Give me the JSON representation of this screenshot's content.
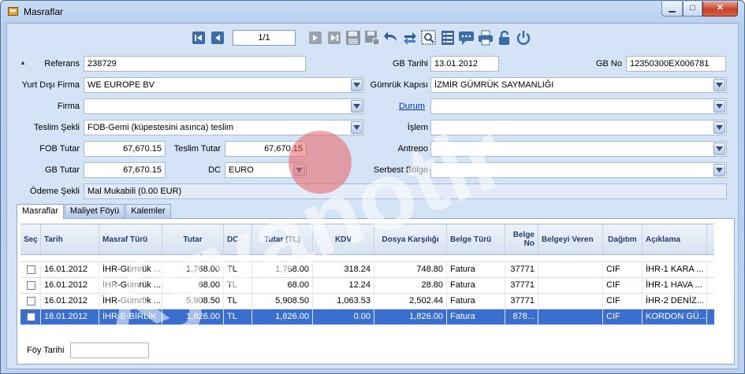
{
  "window": {
    "title": "Masraflar",
    "controls": {
      "minimize": "▁",
      "maximize": "□",
      "close": "✕"
    }
  },
  "toolbar": {
    "pager": "1/1",
    "icons": [
      "first-page-icon",
      "prev-page-icon",
      "next-page-icon",
      "last-page-icon",
      "save-icon",
      "save-as-icon",
      "undo-icon",
      "refresh-icon",
      "search-icon",
      "list-icon",
      "comment-icon",
      "print-icon",
      "lock-icon",
      "power-icon"
    ]
  },
  "form": {
    "referans_label": "Referans",
    "referans_value": "238729",
    "gb_tarihi_label": "GB Tarihi",
    "gb_tarihi_value": "13.01.2012",
    "gb_no_label": "GB No",
    "gb_no_value": "12350300EX006781",
    "yurt_disi_firma_label": "Yurt Dışı Firma",
    "yurt_disi_firma_value": "WE EUROPE BV",
    "gumruk_kapisi_label": "Gümrük Kapısı",
    "gumruk_kapisi_value": "İZMİR GÜMRÜK SAYMANLIĞI",
    "firma_label": "Firma",
    "firma_value": "",
    "durum_label": "Durum",
    "durum_value": "",
    "teslim_sekli_label": "Teslim Şekli",
    "teslim_sekli_value": "FOB-Gemi (küpestesini asınca) teslim",
    "islem_label": "İşlem",
    "islem_value": "",
    "fob_tutar_label": "FOB Tutar",
    "fob_tutar_value": "67,670.15",
    "teslim_tutar_label": "Teslim Tutar",
    "teslim_tutar_value": "67,670.15",
    "antrepo_label": "Antrepo",
    "antrepo_value": "",
    "gb_tutar_label": "GB Tutar",
    "gb_tutar_value": "67,670.15",
    "dc_label": "DC",
    "dc_value": "EURO",
    "serbest_bolge_label": "Serbest Bölge",
    "serbest_bolge_value": "",
    "odeme_sekli_label": "Ödeme Şekli",
    "odeme_sekli_value": "Mal Mukabili (0.00 EUR)"
  },
  "tabs": [
    {
      "label": "Masraflar"
    },
    {
      "label": "Maliyet Föyü"
    },
    {
      "label": "Kalemler"
    }
  ],
  "grid": {
    "columns": [
      "Seç",
      "Tarih",
      "Masraf Türü",
      "Tutar",
      "DC",
      "Tutar (TL)",
      "KDV",
      "Dosya Karşılığı",
      "Belge Türü",
      "Belge No",
      "Belgeyi Veren",
      "Dağıtım",
      "Açıklama"
    ],
    "rows": [
      {
        "tarih": "16.01.2012",
        "masraf": "İHR-Gümrük ...",
        "tutar": "1,768.00",
        "dc": "TL",
        "tutar_tl": "1,768.00",
        "kdv": "318.24",
        "dosya": "748.80",
        "belge_turu": "Fatura",
        "belge_no": "37771",
        "veren": "",
        "dagitim": "CIF",
        "aciklama": "İHR-1 KARA ..."
      },
      {
        "tarih": "16.01.2012",
        "masraf": "İHR-Gümrük ...",
        "tutar": "68.00",
        "dc": "TL",
        "tutar_tl": "68.00",
        "kdv": "12.24",
        "dosya": "28.80",
        "belge_turu": "Fatura",
        "belge_no": "37771",
        "veren": "",
        "dagitim": "CIF",
        "aciklama": "İHR-1 HAVA ..."
      },
      {
        "tarih": "16.01.2012",
        "masraf": "İHR-Gümrük ...",
        "tutar": "5,908.50",
        "dc": "TL",
        "tutar_tl": "5,908.50",
        "kdv": "1,063.53",
        "dosya": "2,502.44",
        "belge_turu": "Fatura",
        "belge_no": "37771",
        "veren": "",
        "dagitim": "CIF",
        "aciklama": "İHR-2 DENİZ..."
      },
      {
        "tarih": "18.01.2012",
        "masraf": "İHR-E-BİRLİK",
        "tutar": "1,826.00",
        "dc": "TL",
        "tutar_tl": "1,826.00",
        "kdv": "0.00",
        "dosya": "1,826.00",
        "belge_turu": "Fatura",
        "belge_no": "878...",
        "veren": "",
        "dagitim": "CIF",
        "aciklama": "KORDON GÜ..."
      }
    ]
  },
  "foy": {
    "label": "Föy Tarihi",
    "value": ""
  },
  "watermark": "Xyvanotir",
  "colors": {
    "selection": "#3a6fd0",
    "link": "#0a30c0"
  }
}
